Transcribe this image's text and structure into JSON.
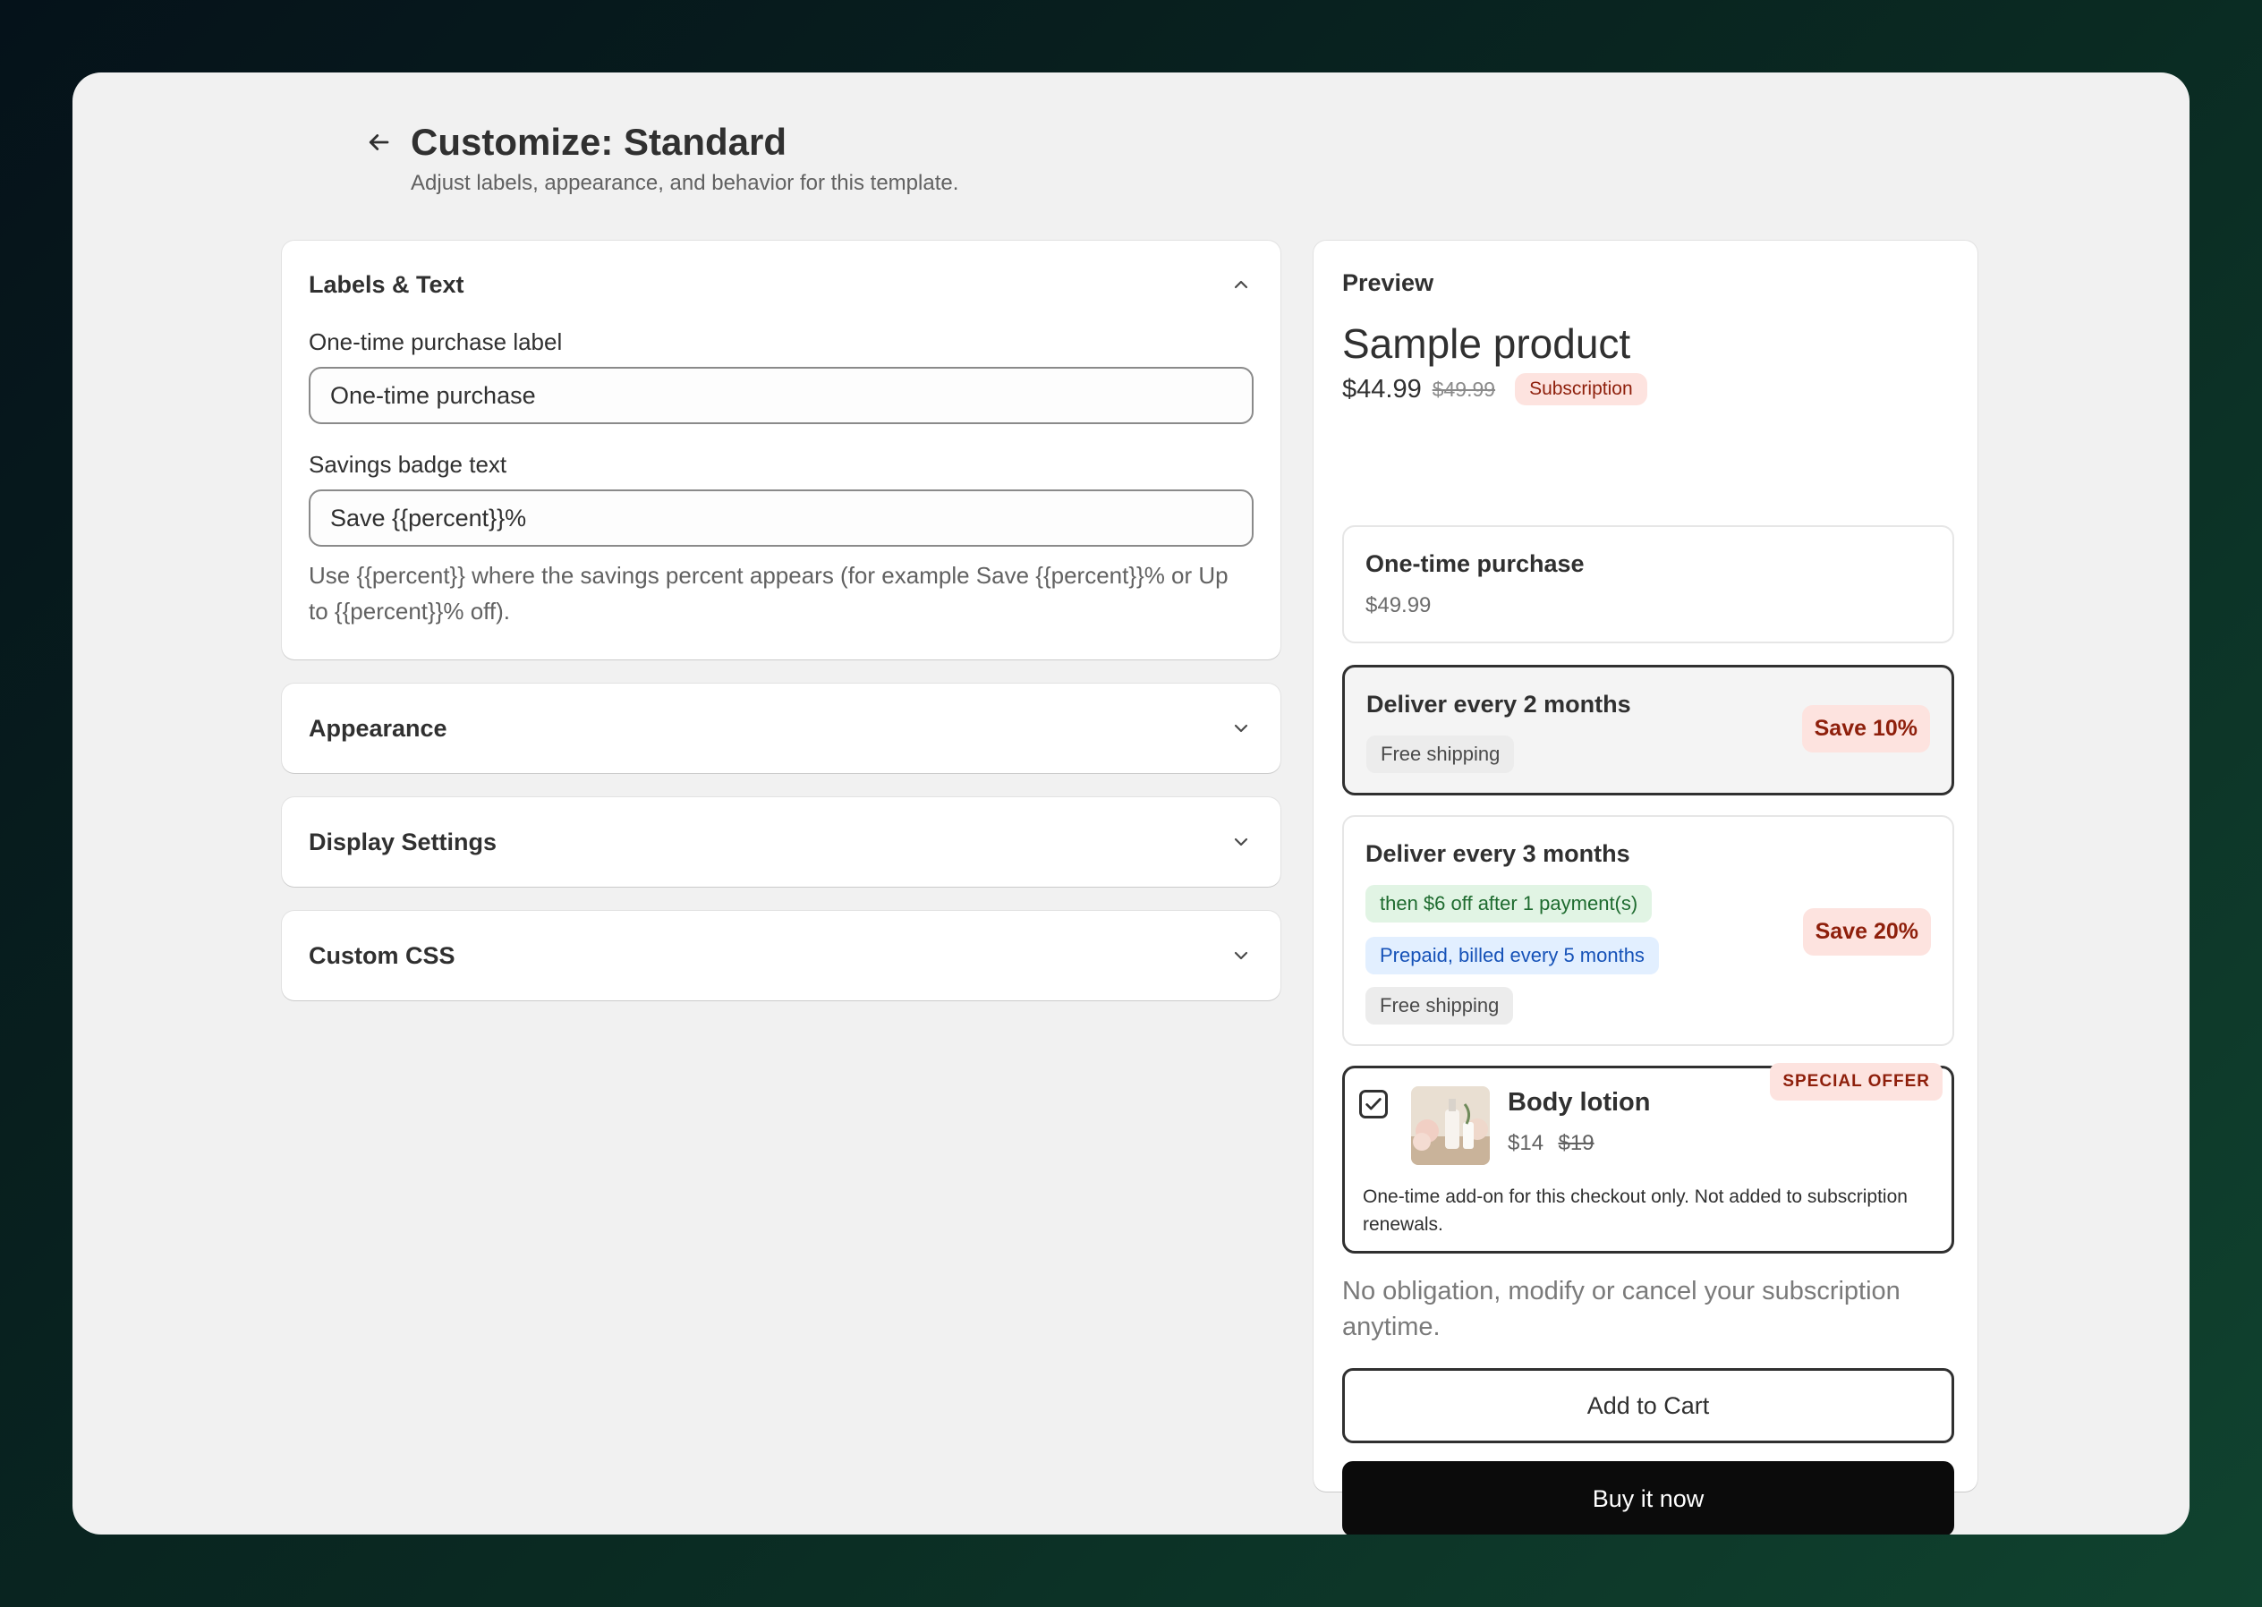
{
  "header": {
    "title": "Customize: Standard",
    "subtitle": "Adjust labels, appearance, and behavior for this template."
  },
  "sections": {
    "labels": {
      "title": "Labels & Text",
      "one_time_label": "One-time purchase label",
      "one_time_value": "One-time purchase",
      "savings_label": "Savings badge text",
      "savings_value": "Save {{percent}}%",
      "help": "Use {{percent}} where the savings percent appears (for example Save {{percent}}% or Up to {{percent}}% off)."
    },
    "appearance": {
      "title": "Appearance"
    },
    "display": {
      "title": "Display Settings"
    },
    "css": {
      "title": "Custom CSS"
    }
  },
  "preview": {
    "heading": "Preview",
    "product": "Sample product",
    "price": "$44.99",
    "compare_price": "$49.99",
    "badge": "Subscription",
    "options": [
      {
        "title": "One-time purchase",
        "subtitle": "$49.99",
        "selected": false
      },
      {
        "title": "Deliver every 2 months",
        "chips": [
          "Free shipping"
        ],
        "save": "Save 10%",
        "selected": true
      },
      {
        "title": "Deliver every 3 months",
        "chips": [
          "then $6 off after 1 payment(s)",
          "Prepaid, billed every 5 months",
          "Free shipping"
        ],
        "save": "Save 20%",
        "selected": false
      }
    ],
    "offer": {
      "flag": "SPECIAL OFFER",
      "name": "Body lotion",
      "price": "$14",
      "compare_price": "$19",
      "checked": true,
      "note": "One-time add-on for this checkout only. Not added to subscription renewals."
    },
    "disclaimer": "No obligation, modify or cancel your subscription anytime.",
    "add_to_cart": "Add to Cart",
    "buy_now": "Buy it now"
  },
  "colors": {
    "accent_dark": "#303030",
    "badge_bg": "#fde3df",
    "badge_text": "#8e1f0b",
    "chip_green_bg": "#e1f4e4",
    "chip_blue_bg": "#e2efff",
    "buy_button": "#0b0b0b"
  },
  "icons": {
    "back": "arrow-left-icon",
    "expand": "chevron-down-icon",
    "collapse": "chevron-up-icon",
    "check": "checkmark-icon"
  }
}
